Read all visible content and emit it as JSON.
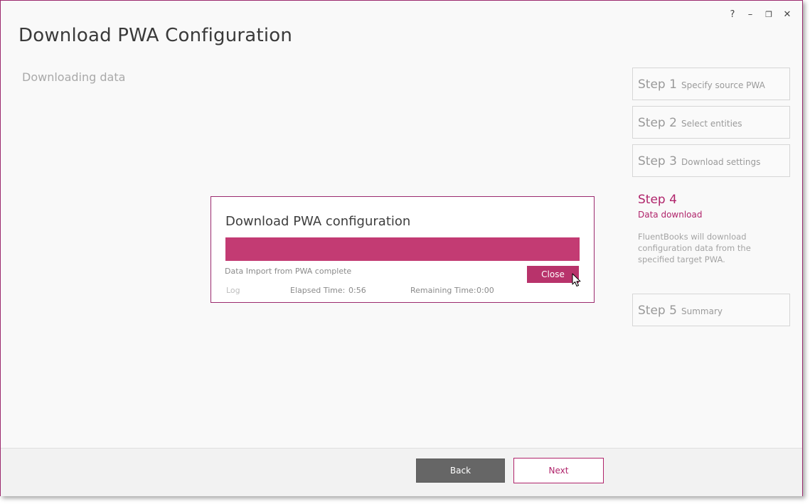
{
  "window": {
    "title": "Download PWA Configuration",
    "controls": {
      "help": "?",
      "minimize": "–",
      "restore": "❐",
      "close": "✕"
    }
  },
  "main": {
    "subtitle": "Downloading data"
  },
  "steps": [
    {
      "num": "Step 1",
      "label": "Specify source PWA"
    },
    {
      "num": "Step 2",
      "label": "Select entities"
    },
    {
      "num": "Step 3",
      "label": "Download settings"
    },
    {
      "num": "Step 4",
      "label": "Data download",
      "description": "FluentBooks will download configuration data from the specified target PWA."
    },
    {
      "num": "Step 5",
      "label": "Summary"
    }
  ],
  "dialog": {
    "title": "Download PWA configuration",
    "progress": 1.0,
    "status": "Data Import from PWA complete",
    "close_label": "Close",
    "log_label": "Log",
    "elapsed_label": "Elapsed Time:",
    "elapsed_value": "0:56",
    "remaining_label": "Remaining Time:",
    "remaining_value": "0:00"
  },
  "footer": {
    "back_label": "Back",
    "next_label": "Next"
  },
  "colors": {
    "accent": "#b0246b",
    "progress": "#c33b73",
    "back_button": "#666666"
  }
}
